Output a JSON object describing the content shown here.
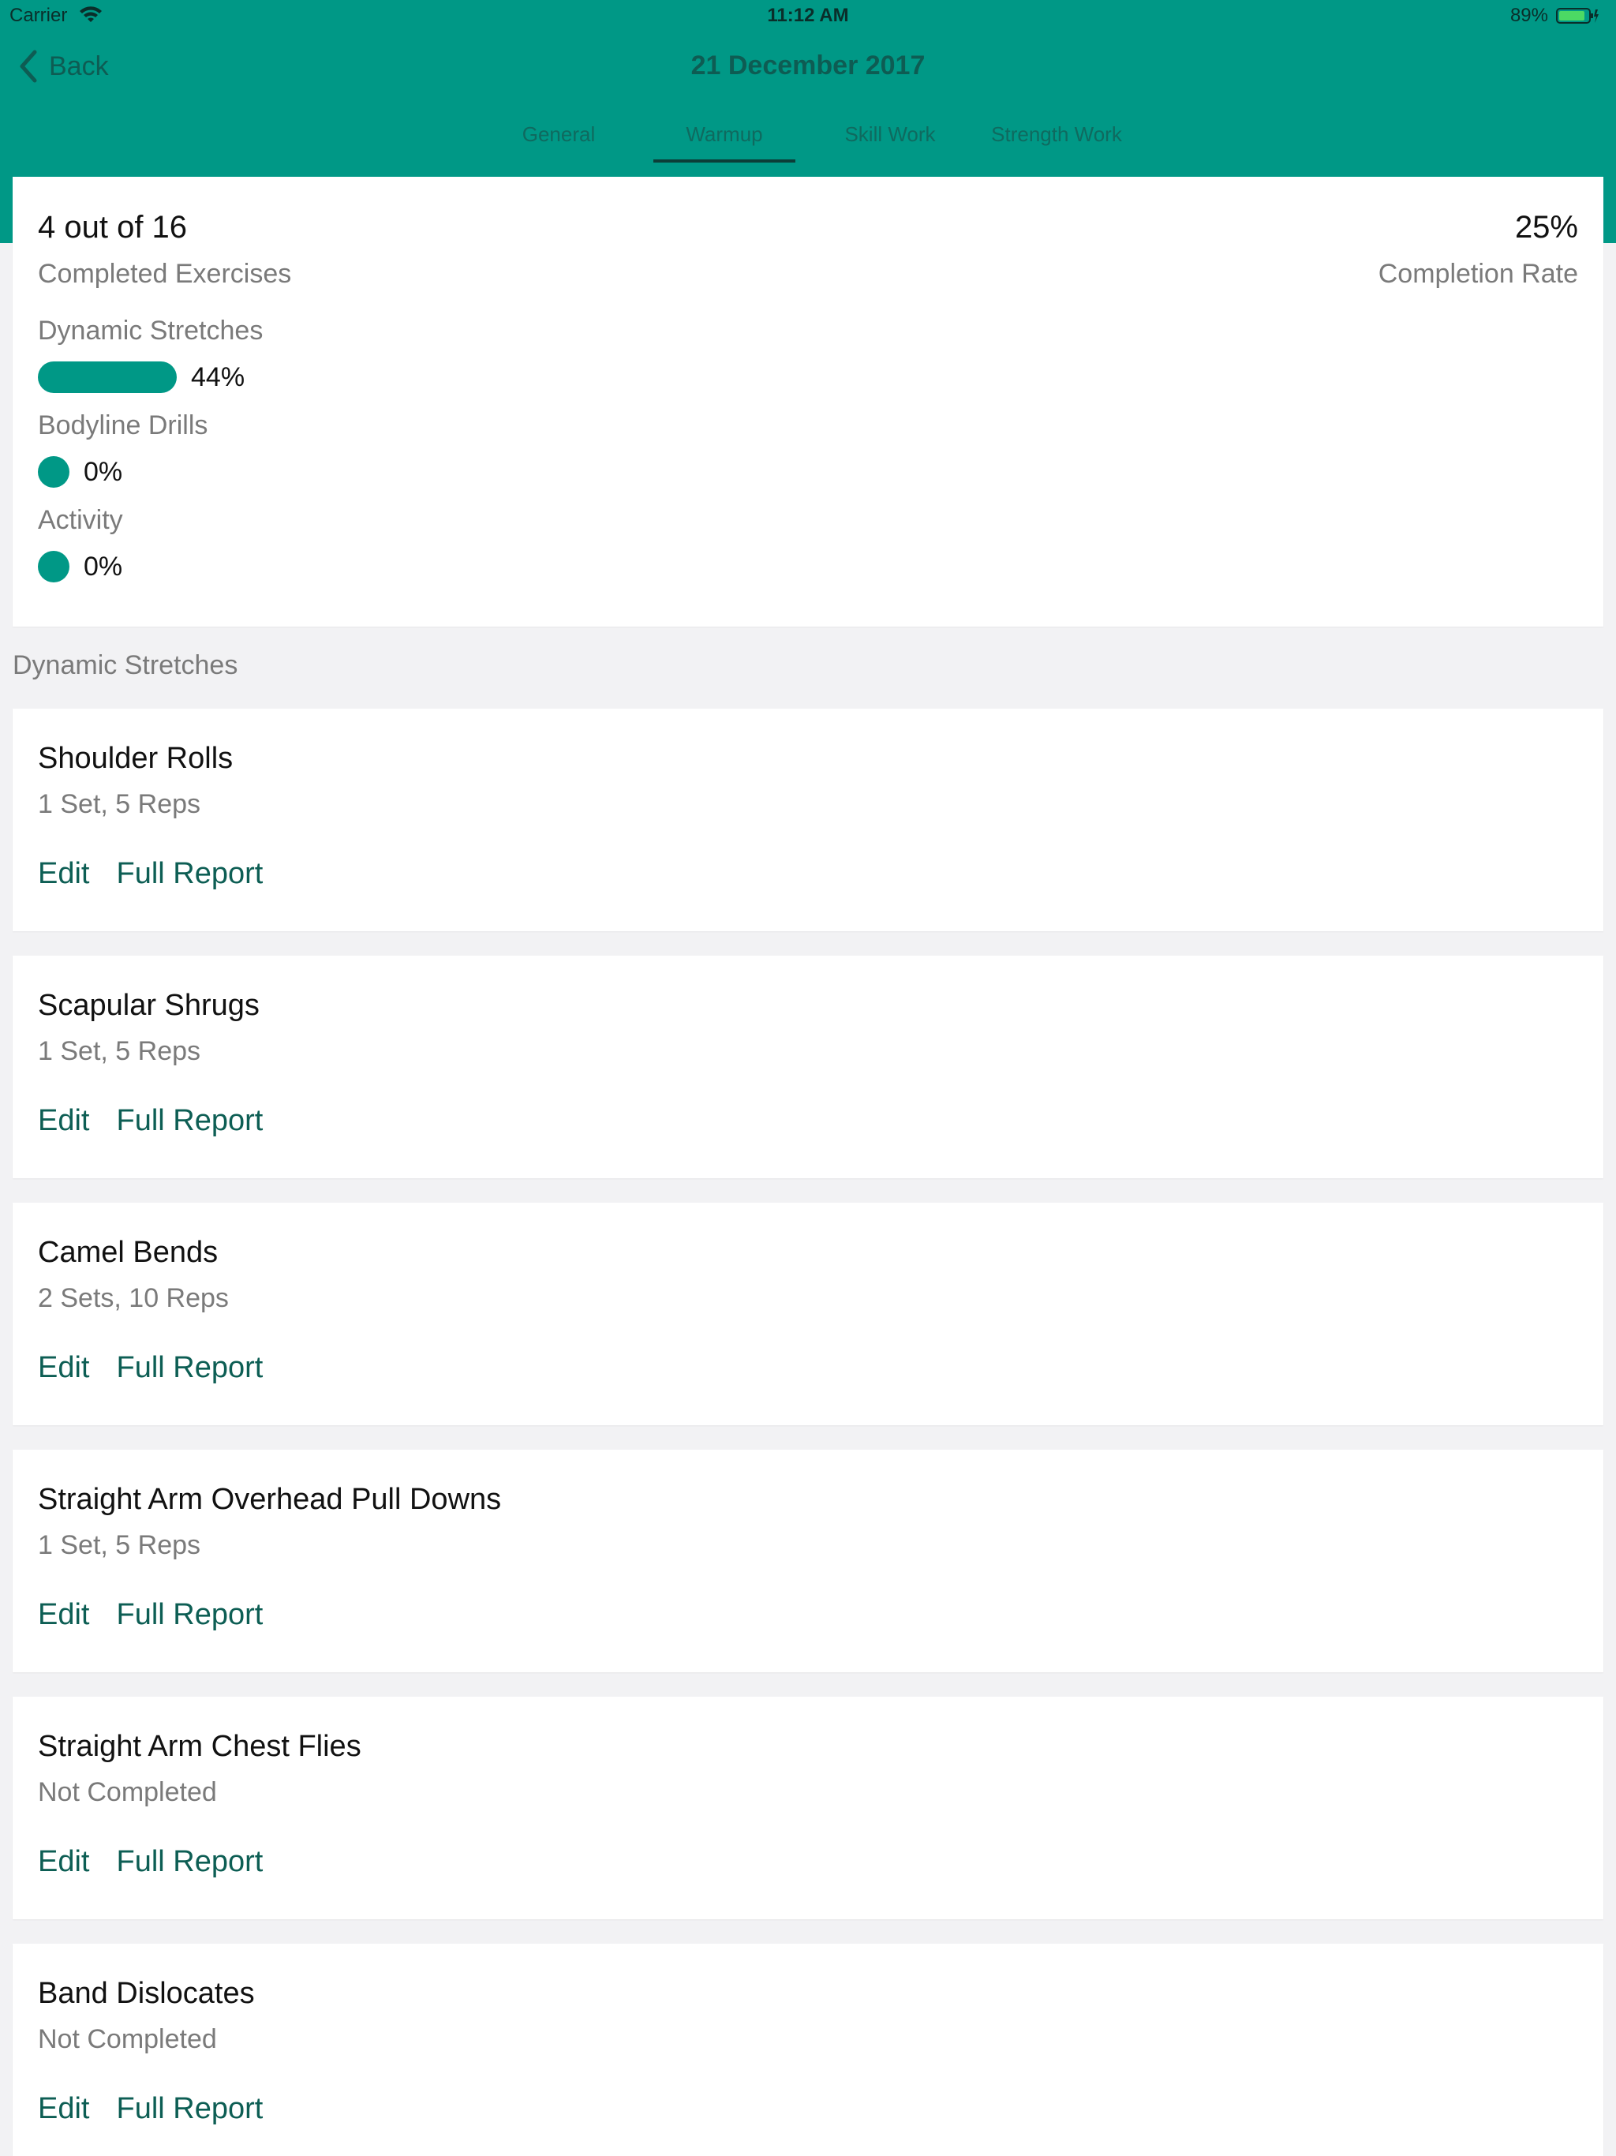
{
  "status_bar": {
    "carrier": "Carrier",
    "time": "11:12 AM",
    "battery": "89%",
    "battery_level": 0.89,
    "icons": [
      "wifi-icon",
      "battery-icon",
      "charging-bolt-icon"
    ]
  },
  "nav": {
    "back_label": "Back",
    "title": "21 December 2017"
  },
  "tabs": [
    {
      "label": "General",
      "active": false
    },
    {
      "label": "Warmup",
      "active": true
    },
    {
      "label": "Skill Work",
      "active": false
    },
    {
      "label": "Strength Work",
      "active": false
    }
  ],
  "summary": {
    "count_text": "4 out of 16",
    "count_label": "Completed Exercises",
    "rate_text": "25%",
    "rate_label": "Completion Rate",
    "categories": [
      {
        "name": "Dynamic Stretches",
        "percent_text": "44%",
        "percent": 44
      },
      {
        "name": "Bodyline Drills",
        "percent_text": "0%",
        "percent": 0
      },
      {
        "name": "Activity",
        "percent_text": "0%",
        "percent": 0
      }
    ]
  },
  "section_header": "Dynamic Stretches",
  "exercises": [
    {
      "name": "Shoulder Rolls",
      "status": "1 Set, 5 Reps"
    },
    {
      "name": "Scapular Shrugs",
      "status": "1 Set, 5 Reps"
    },
    {
      "name": "Camel Bends",
      "status": "2 Sets, 10 Reps"
    },
    {
      "name": "Straight Arm Overhead Pull Downs",
      "status": "1 Set, 5 Reps"
    },
    {
      "name": "Straight Arm Chest Flies",
      "status": "Not Completed"
    },
    {
      "name": "Band Dislocates",
      "status": "Not Completed"
    }
  ],
  "actions": {
    "edit_label": "Edit",
    "report_label": "Full Report"
  },
  "colors": {
    "accent": "#009886",
    "header_text": "#0e5c53",
    "link": "#0d5e54",
    "background": "#f2f2f4"
  }
}
